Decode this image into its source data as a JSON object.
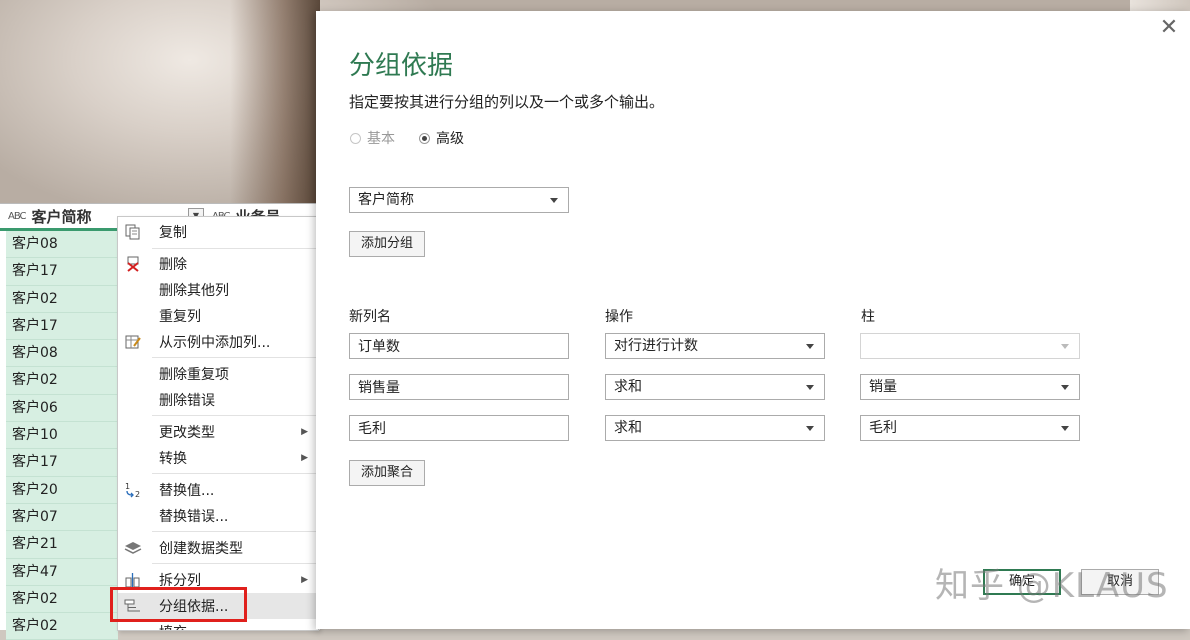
{
  "grid": {
    "columns": [
      {
        "type_icon": "ABC",
        "name": "客户简称"
      },
      {
        "type_icon": "ABC",
        "name": "业务员"
      }
    ],
    "rows": [
      "客户08",
      "客户17",
      "客户02",
      "客户17",
      "客户08",
      "客户02",
      "客户06",
      "客户10",
      "客户17",
      "客户20",
      "客户07",
      "客户21",
      "客户47",
      "客户02",
      "客户02"
    ]
  },
  "context_menu": {
    "items": [
      {
        "label": "复制",
        "icon": "copy-icon"
      },
      {
        "label": "删除",
        "icon": "delete-icon"
      },
      {
        "label": "删除其他列"
      },
      {
        "label": "重复列"
      },
      {
        "label": "从示例中添加列...",
        "icon": "add-column-example-icon"
      },
      {
        "label": "删除重复项"
      },
      {
        "label": "删除错误"
      },
      {
        "label": "更改类型",
        "submenu": true
      },
      {
        "label": "转换",
        "submenu": true
      },
      {
        "label": "替换值...",
        "icon": "replace-values-icon"
      },
      {
        "label": "替换错误..."
      },
      {
        "label": "创建数据类型",
        "icon": "data-type-icon"
      },
      {
        "label": "拆分列",
        "icon": "split-column-icon",
        "submenu": true
      },
      {
        "label": "分组依据...",
        "icon": "group-by-icon",
        "highlighted": true
      },
      {
        "label": "填充"
      }
    ]
  },
  "dialog": {
    "title": "分组依据",
    "description": "指定要按其进行分组的列以及一个或多个输出。",
    "mode_basic": "基本",
    "mode_advanced": "高级",
    "selected_mode": "高级",
    "group_column": "客户简称",
    "add_group_label": "添加分组",
    "headers": {
      "new_col": "新列名",
      "operation": "操作",
      "column": "柱"
    },
    "aggregations": [
      {
        "name": "订单数",
        "operation": "对行进行计数",
        "column": ""
      },
      {
        "name": "销售量",
        "operation": "求和",
        "column": "销量"
      },
      {
        "name": "毛利",
        "operation": "求和",
        "column": "毛利"
      }
    ],
    "add_aggregation_label": "添加聚合",
    "ok_label": "确定",
    "cancel_label": "取消",
    "close_glyph": "✕"
  },
  "watermark": "知乎 @KLAUS",
  "colors": {
    "accent": "#2f7a52",
    "grid_fill": "#d7efe2",
    "highlight_box": "#e0201c"
  }
}
